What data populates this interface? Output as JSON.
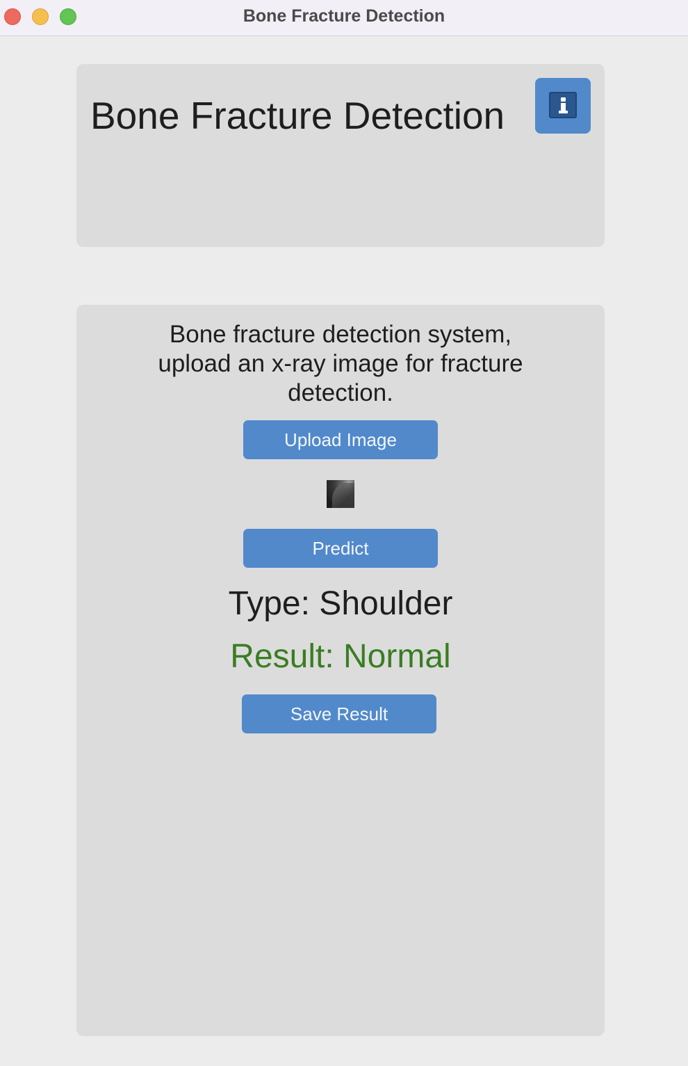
{
  "window": {
    "title": "Bone Fracture Detection"
  },
  "header": {
    "heading": "Bone Fracture Detection",
    "info_icon": "info-icon"
  },
  "main": {
    "description": "Bone fracture detection system, upload an x-ray image for fracture detection.",
    "upload_button": "Upload Image",
    "predict_button": "Predict",
    "type_text": "Type: Shoulder",
    "result_text": "Result: Normal",
    "save_button": "Save Result"
  },
  "colors": {
    "accent": "#5189cb",
    "result_normal": "#3a7d22"
  }
}
